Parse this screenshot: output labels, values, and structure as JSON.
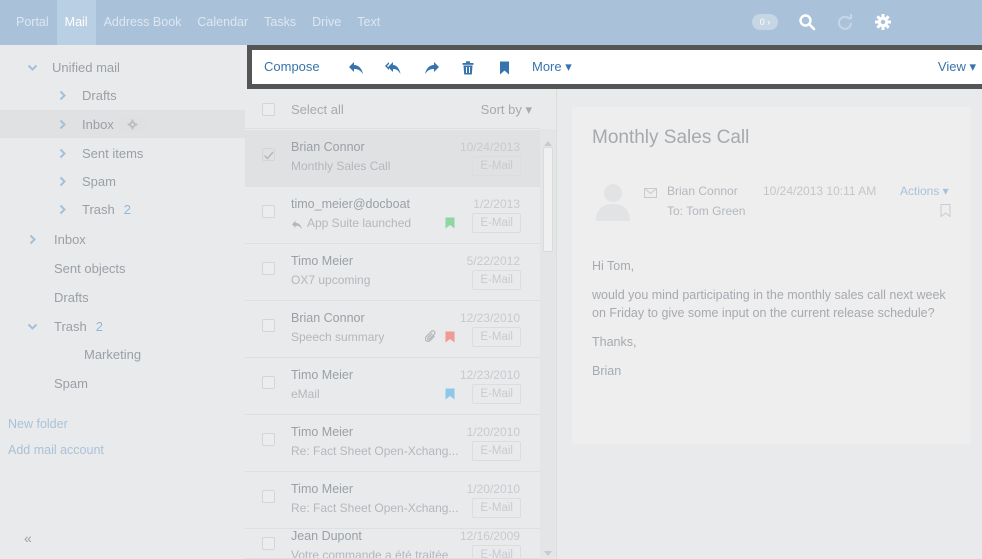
{
  "top_nav": {
    "items": [
      "Portal",
      "Mail",
      "Address Book",
      "Calendar",
      "Tasks",
      "Drive",
      "Text"
    ],
    "active": "Mail",
    "badge": "0 ›"
  },
  "sidebar": {
    "folders": [
      {
        "label": "Unified mail",
        "level": 0,
        "expanded": true
      },
      {
        "label": "Drafts",
        "level": 1
      },
      {
        "label": "Inbox",
        "level": 1,
        "selected": true
      },
      {
        "label": "Sent items",
        "level": 1
      },
      {
        "label": "Spam",
        "level": 1
      },
      {
        "label": "Trash",
        "level": 1,
        "count": "2"
      },
      {
        "label": "Inbox",
        "level": 0
      },
      {
        "label": "Sent objects",
        "level": 0
      },
      {
        "label": "Drafts",
        "level": 0
      },
      {
        "label": "Trash",
        "level": 0,
        "count": "2",
        "expanded": true
      },
      {
        "label": "Marketing",
        "level": 1
      },
      {
        "label": "Spam",
        "level": 0
      }
    ],
    "new_folder": "New folder",
    "add_account": "Add mail account",
    "collapse": "«"
  },
  "toolbar": {
    "compose": "Compose",
    "more": "More ▾",
    "view": "View ▾"
  },
  "list": {
    "select_all": "Select all",
    "sort_by": "Sort by ▾",
    "rows": [
      {
        "from": "Brian Connor",
        "subject": "Monthly Sales Call",
        "date": "10/24/2013",
        "tag": "E-Mail",
        "selected": true
      },
      {
        "from": "timo_meier@docboat",
        "subject": "App Suite launched",
        "date": "1/2/2013",
        "tag": "E-Mail",
        "replied": true,
        "flag": "green"
      },
      {
        "from": "Timo Meier",
        "subject": "OX7 upcoming",
        "date": "5/22/2012",
        "tag": "E-Mail"
      },
      {
        "from": "Brian Connor",
        "subject": "Speech summary",
        "date": "12/23/2010",
        "tag": "E-Mail",
        "attachment": true,
        "flag": "red"
      },
      {
        "from": "Timo Meier",
        "subject": "eMail",
        "date": "12/23/2010",
        "tag": "E-Mail",
        "flag": "blue"
      },
      {
        "from": "Timo Meier",
        "subject": "Re: Fact Sheet Open-Xchang...",
        "date": "1/20/2010",
        "tag": "E-Mail"
      },
      {
        "from": "Timo Meier",
        "subject": "Re: Fact Sheet Open-Xchang...",
        "date": "1/20/2010",
        "tag": "E-Mail"
      },
      {
        "from": "Jean Dupont",
        "subject": "Votre commande a été traitée",
        "date": "12/16/2009",
        "tag": "E-Mail"
      }
    ]
  },
  "detail": {
    "subject": "Monthly Sales Call",
    "sender": "Brian Connor",
    "datetime": "10/24/2013 10:11 AM",
    "actions": "Actions ▾",
    "to": "To: Tom Green",
    "body": [
      "Hi Tom,",
      "would you mind participating in the monthly sales call next week on Friday to give some input on the current release schedule?",
      "Thanks,",
      "Brian"
    ]
  },
  "colors": {
    "accent": "#3774ad",
    "topbar": "#a9c2d9",
    "frame": "#555555",
    "flag_green": "#8fd7a2",
    "flag_red": "#f09a94",
    "flag_blue": "#8ec8e8"
  }
}
